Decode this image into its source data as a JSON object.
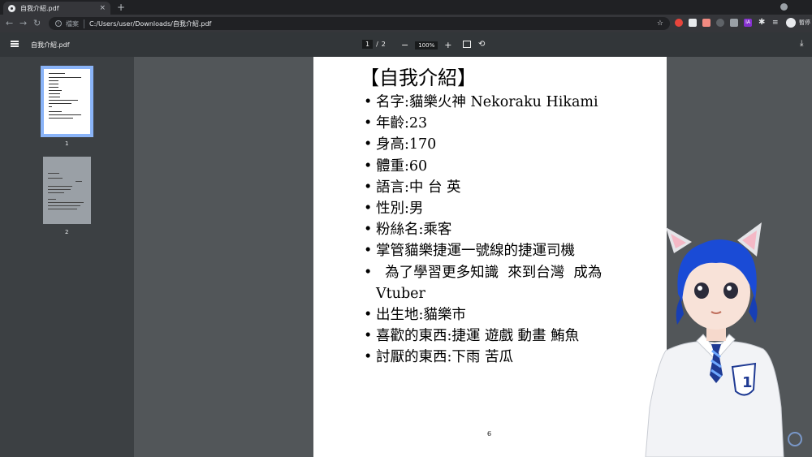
{
  "browser": {
    "tab": {
      "title": "自我介紹.pdf",
      "close": "×"
    },
    "new_tab": "+",
    "omnibox": {
      "security_label": "檔案",
      "url": "C:/Users/user/Downloads/自我介紹.pdf"
    },
    "profile_label": "暫停",
    "extension_label": "IA"
  },
  "pdf_toolbar": {
    "document_title": "自我介紹.pdf",
    "current_page": "1",
    "page_separator": "/",
    "total_pages": "2",
    "zoom": "100%",
    "zoom_out": "−",
    "zoom_in": "+"
  },
  "sidebar": {
    "thumbnails": [
      {
        "label": "1"
      },
      {
        "label": "2"
      }
    ]
  },
  "pdf_page": {
    "title": "【自我介紹】",
    "items": [
      "名字:貓樂火神  Nekoraku Hikami",
      "年齡:23",
      "身高:170",
      "體重:60",
      "語言:中  台  英",
      "性別:男",
      "粉絲名:乘客",
      "掌管貓樂捷運一號線的捷運司機",
      "  為了學習更多知識  來到台灣  成為",
      "出生地:貓樂市",
      "喜歡的東西:捷運  遊戲  動畫  鮪魚",
      "討厭的東西:下雨  苦瓜"
    ],
    "item_continuation": "Vtuber",
    "page_number": "6"
  },
  "avatar_badge": "1",
  "colors": {
    "accent": "#8ab4f8",
    "viewer_bg": "#525659",
    "toolbar_bg": "#323639"
  }
}
